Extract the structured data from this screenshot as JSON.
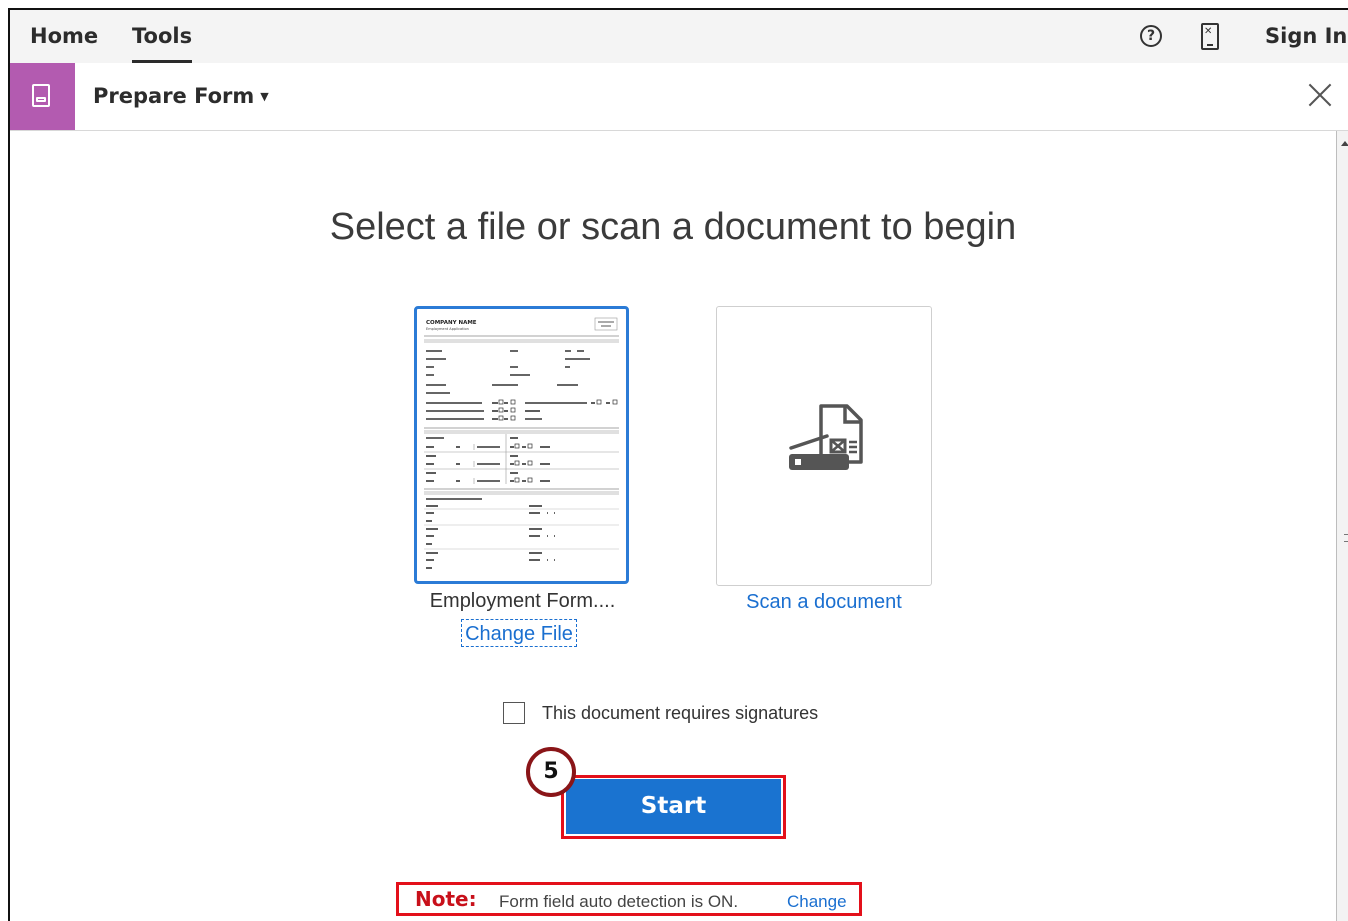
{
  "topbar": {
    "home_label": "Home",
    "tools_label": "Tools",
    "help_glyph": "?",
    "signin_label": "Sign In"
  },
  "toolbar": {
    "title": "Prepare Form",
    "tile_color": "#b35bb0"
  },
  "main": {
    "heading": "Select a file or scan a document to begin",
    "file_name": "Employment Form....",
    "change_file_label": "Change File",
    "scan_label": "Scan a document",
    "signature_checkbox_label": "This document requires signatures",
    "signature_checked": false,
    "start_label": "Start",
    "step_number": "5",
    "note_label": "Note:",
    "note_text": "Form field auto detection is ON.",
    "note_change_label": "Change"
  },
  "thumbnail": {
    "company_name": "COMPANY NAME",
    "subtitle": "Employment Application"
  },
  "colors": {
    "accent_blue": "#1a73d0",
    "highlight_red": "#e3101a"
  },
  "icons": [
    "help-icon",
    "mobile-icon",
    "form-tool-icon",
    "caret-down-icon",
    "close-icon",
    "scanner-icon"
  ]
}
